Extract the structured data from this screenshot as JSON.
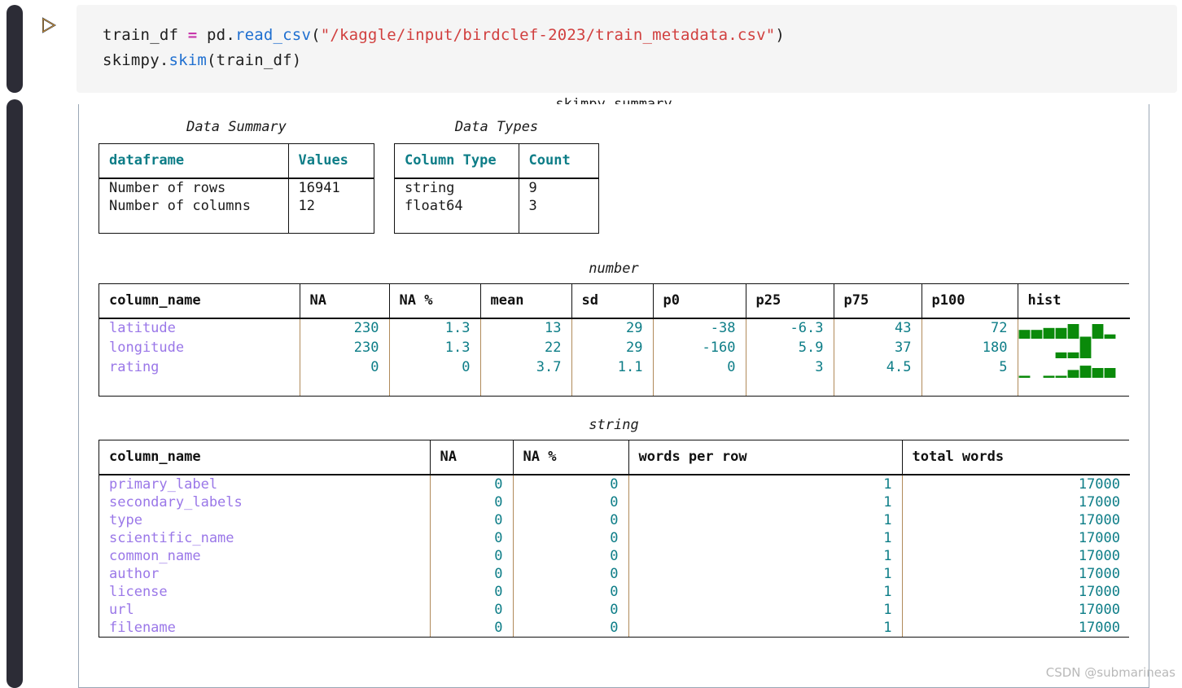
{
  "notebook": {
    "run_icon": "run-cell-triangle-icon",
    "code_lines": [
      [
        {
          "t": "train_df ",
          "c": "pl"
        },
        {
          "t": "=",
          "c": "op"
        },
        {
          "t": " pd.",
          "c": "pl"
        },
        {
          "t": "read_csv",
          "c": "fn"
        },
        {
          "t": "(",
          "c": "pl"
        },
        {
          "t": "\"/kaggle/input/birdclef-2023/train_metadata.csv\"",
          "c": "str"
        },
        {
          "t": ")",
          "c": "pl"
        }
      ],
      [
        {
          "t": "skimpy.",
          "c": "pl"
        },
        {
          "t": "skim",
          "c": "fn"
        },
        {
          "t": "(train_df)",
          "c": "pl"
        }
      ]
    ]
  },
  "panel": {
    "title": "skimpy summary"
  },
  "data_summary": {
    "caption": "Data Summary",
    "headers": [
      "dataframe",
      "Values"
    ],
    "rows": [
      {
        "label": "Number of rows",
        "value": "16941"
      },
      {
        "label": "Number of columns",
        "value": "12"
      }
    ]
  },
  "data_types": {
    "caption": "Data Types",
    "headers": [
      "Column Type",
      "Count"
    ],
    "rows": [
      {
        "label": "string",
        "value": "9"
      },
      {
        "label": "float64",
        "value": "3"
      }
    ]
  },
  "number_table": {
    "caption": "number",
    "headers": [
      "column_name",
      "NA",
      "NA %",
      "mean",
      "sd",
      "p0",
      "p25",
      "p75",
      "p100",
      "hist"
    ],
    "rows": [
      {
        "column_name": "latitude",
        "NA": "230",
        "NA_pct": "1.3",
        "mean": "13",
        "sd": "29",
        "p0": "-38",
        "p25": "-6.3",
        "p75": "43",
        "p100": "72",
        "hist": [
          0.45,
          0.45,
          0.55,
          0.55,
          0.75,
          0.08,
          0.75,
          0.22
        ]
      },
      {
        "column_name": "longitude",
        "NA": "230",
        "NA_pct": "1.3",
        "mean": "22",
        "sd": "29",
        "p0": "-160",
        "p25": "5.9",
        "p75": "37",
        "p100": "180",
        "hist": [
          0.0,
          0.0,
          0.0,
          0.3,
          0.3,
          1.0,
          0.0,
          0.0
        ]
      },
      {
        "column_name": "rating",
        "NA": "0",
        "NA_pct": "0",
        "mean": "3.7",
        "sd": "1.1",
        "p0": "0",
        "p25": "3",
        "p75": "4.5",
        "p100": "5",
        "hist": [
          0.06,
          0.0,
          0.06,
          0.06,
          0.4,
          0.62,
          0.5,
          0.5
        ]
      }
    ],
    "hist_color": "#0a8a0a"
  },
  "string_table": {
    "caption": "string",
    "headers": [
      "column_name",
      "NA",
      "NA %",
      "words per row",
      "total words"
    ],
    "rows": [
      {
        "column_name": "primary_label",
        "NA": "0",
        "NA_pct": "0",
        "words_per_row": "1",
        "total_words": "17000"
      },
      {
        "column_name": "secondary_labels",
        "NA": "0",
        "NA_pct": "0",
        "words_per_row": "1",
        "total_words": "17000"
      },
      {
        "column_name": "type",
        "NA": "0",
        "NA_pct": "0",
        "words_per_row": "1",
        "total_words": "17000"
      },
      {
        "column_name": "scientific_name",
        "NA": "0",
        "NA_pct": "0",
        "words_per_row": "1",
        "total_words": "17000"
      },
      {
        "column_name": "common_name",
        "NA": "0",
        "NA_pct": "0",
        "words_per_row": "1",
        "total_words": "17000"
      },
      {
        "column_name": "author",
        "NA": "0",
        "NA_pct": "0",
        "words_per_row": "1",
        "total_words": "17000"
      },
      {
        "column_name": "license",
        "NA": "0",
        "NA_pct": "0",
        "words_per_row": "1",
        "total_words": "17000"
      },
      {
        "column_name": "url",
        "NA": "0",
        "NA_pct": "0",
        "words_per_row": "1",
        "total_words": "17000"
      },
      {
        "column_name": "filename",
        "NA": "0",
        "NA_pct": "0",
        "words_per_row": "1",
        "total_words": "17000"
      }
    ]
  },
  "watermark": "CSDN @submarineas",
  "colors": {
    "teal": "#0d7d87",
    "purple": "#9a77e8",
    "hist_green": "#0a8a0a",
    "string_red": "#d1403f",
    "func_blue": "#1f6fd0",
    "op_magenta": "#c837ab"
  }
}
